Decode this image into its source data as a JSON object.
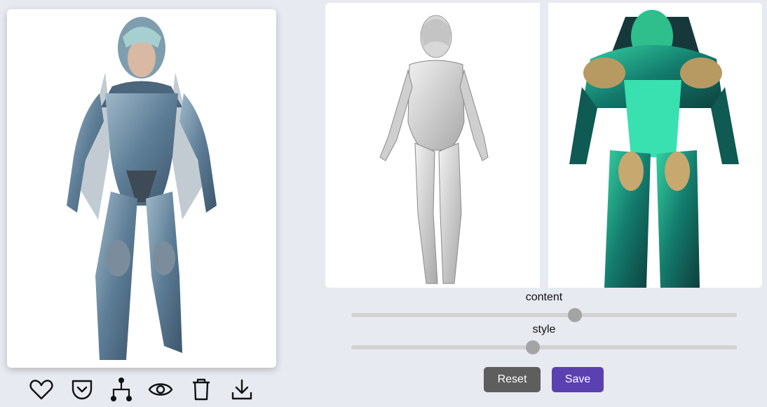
{
  "result_image": {
    "subject": "blue armored female character"
  },
  "content_image": {
    "subject": "grayscale female character sketch"
  },
  "style_image": {
    "subject": "green ornate armored character"
  },
  "toolbar": {
    "icons": [
      "heart-icon",
      "pocket-icon",
      "branch-icon",
      "eye-icon",
      "trash-icon",
      "download-icon"
    ]
  },
  "sliders": {
    "content": {
      "label": "content",
      "value": 0.58
    },
    "style": {
      "label": "style",
      "value": 0.47
    }
  },
  "buttons": {
    "reset_label": "Reset",
    "save_label": "Save"
  },
  "colors": {
    "background": "#e7eaf1",
    "reset": "#5e5e5e",
    "save": "#5a40b0",
    "thumb": "#a4a4a4"
  }
}
